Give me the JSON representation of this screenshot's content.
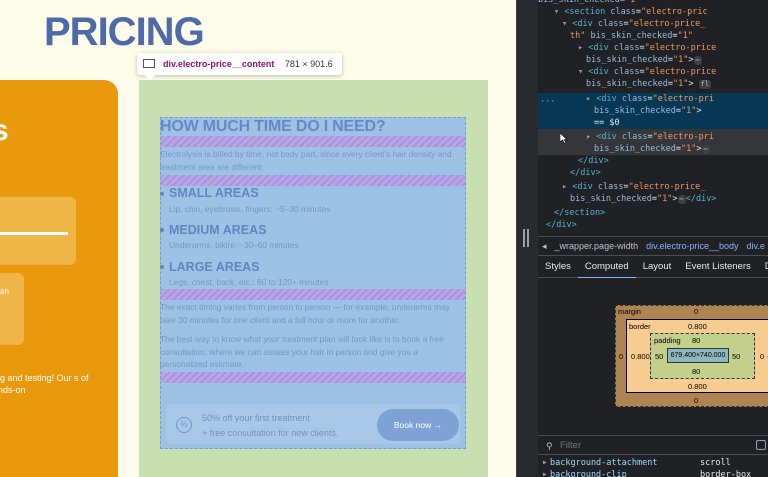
{
  "page": {
    "title": "PRICING",
    "orange_card": {
      "big_letter": "s",
      "small_label": "an",
      "text": "ning and testing! Our s of hands-on"
    },
    "content": {
      "heading": "HOW MUCH TIME DO I NEED?",
      "intro": "Electrolysis is billed by time, not body part, since every client's hair density and treatment area are different.",
      "areas": [
        {
          "title": "SMALL AREAS",
          "desc": "Lip, chin, eyebrows, fingers: ~5–30 minutes"
        },
        {
          "title": "MEDIUM AREAS",
          "desc": "Underarms, bikini: ~30–60 minutes"
        },
        {
          "title": "LARGE AREAS",
          "desc": "Legs, chest, back, etc.: 60 to 120+ minutes"
        }
      ],
      "para2": "The exact timing varies from person to person — for example, underarms may take 30 minutes for one client and a full hour or more for another.",
      "para3": "The best way to know what your treatment plan will look like is to book a free consultation, where we can assess your hair in person and give you a personalized estimate.",
      "promo_line1": "50% off your first treatment",
      "promo_line2": "+ free consultation for new clients.",
      "promo_icon": "%",
      "book_button": "Book now  →"
    },
    "tooltip": {
      "element": "div.electro-price__content",
      "size": "781 × 901.6"
    }
  },
  "devtools": {
    "dom_lines": [
      {
        "indent": 70,
        "arrow": "",
        "html": "<span class='tag'></span><span class='attr'>bis_skin_checked</span>=<span class='val'>\"1\"</span>"
      },
      {
        "indent": 86,
        "arrow": "▾",
        "html": "<span class='tag'>&lt;section</span> <span class='attr'>class</span>=<span class='val'>\"electro-pric</span>"
      },
      {
        "indent": 94,
        "arrow": "▾",
        "html": "<span class='tag'>&lt;div</span> <span class='attr'>class</span>=<span class='val'>\"electro-price_</span>"
      },
      {
        "indent": 102,
        "arrow": "",
        "html": "<span class='val'>th\"</span> <span class='attr'>bis_skin_checked</span>=<span class='val'>\"1\"</span>"
      },
      {
        "indent": 110,
        "arrow": "▸",
        "html": "<span class='tag'>&lt;div</span> <span class='attr'>class</span>=<span class='val'>\"electro-price</span>"
      },
      {
        "indent": 118,
        "arrow": "",
        "html": "<span class='attr'>bis_skin_checked</span>=<span class='val'>\"1\"</span>&gt;<span class='badge'>⋯</span>"
      },
      {
        "indent": 110,
        "arrow": "▾",
        "html": "<span class='tag'>&lt;div</span> <span class='attr'>class</span>=<span class='val'>\"electro-price</span>"
      },
      {
        "indent": 118,
        "arrow": "",
        "html": "<span class='attr'>bis_skin_checked</span>=<span class='val'>\"1\"</span>&gt; <span class='badge'>fl</span>"
      },
      {
        "indent": 118,
        "arrow": "▸",
        "html": "<span class='tag'>&lt;div</span> <span class='attr'>class</span>=<span class='val'>\"electro-pri</span>"
      },
      {
        "indent": 126,
        "arrow": "",
        "html": "<span class='attr'>bis_skin_checked</span>=<span class='val'>\"1\"</span>&gt;"
      },
      {
        "indent": 126,
        "arrow": "",
        "html": "<span class='txt'>== $0</span>"
      },
      {
        "indent": 118,
        "arrow": "▸",
        "html": "<span class='tag'>&lt;div</span> <span class='attr'>class</span>=<span class='val'>\"electro-pri</span>"
      },
      {
        "indent": 126,
        "arrow": "",
        "html": "<span class='attr'>bis_skin_checked</span>=<span class='val'>\"1\"</span>&gt;<span class='badge'>⋯</span>"
      },
      {
        "indent": 110,
        "arrow": "",
        "html": "<span class='tag'>&lt;/div&gt;</span>"
      },
      {
        "indent": 102,
        "arrow": "",
        "html": "<span class='tag'>&lt;/div&gt;</span>"
      },
      {
        "indent": 94,
        "arrow": "▸",
        "html": "<span class='tag'>&lt;div</span> <span class='attr'>class</span>=<span class='val'>\"electro-price_</span>"
      },
      {
        "indent": 102,
        "arrow": "",
        "html": "<span class='attr'>bis_skin_checked</span>=<span class='val'>\"1\"</span>&gt;<span class='badge'>⋯</span><span class='tag'>&lt;/div&gt;</span>"
      },
      {
        "indent": 86,
        "arrow": "",
        "html": "<span class='tag'>&lt;/section&gt;</span>"
      },
      {
        "indent": 78,
        "arrow": "",
        "html": "<span class='tag'>&lt;/div&gt;</span>"
      }
    ],
    "breadcrumbs": [
      "◂",
      "_wrapper.page-width",
      "div.electro-price__body",
      "div.e"
    ],
    "tabs": [
      "Styles",
      "Computed",
      "Layout",
      "Event Listeners",
      "D"
    ],
    "active_tab": "Computed",
    "box_model": {
      "margin_label": "margin",
      "margin_top": "0",
      "margin_bottom": "0",
      "margin_left": "0",
      "margin_right": "0",
      "border_label": "border",
      "border_top": "0.800",
      "border_bottom": "0.800",
      "border_left": "0.800",
      "padding_label": "padding",
      "padding_top": "80",
      "padding_bottom": "80",
      "padding_left": "50",
      "padding_right": "50",
      "content_size": "679.400×740.000",
      "dash": "-"
    },
    "filter_placeholder": "Filter",
    "filter_icon": "⚲",
    "properties": [
      {
        "name": "background-attachment",
        "value": "scroll"
      },
      {
        "name": "background-clip",
        "value": "border-box"
      }
    ]
  }
}
